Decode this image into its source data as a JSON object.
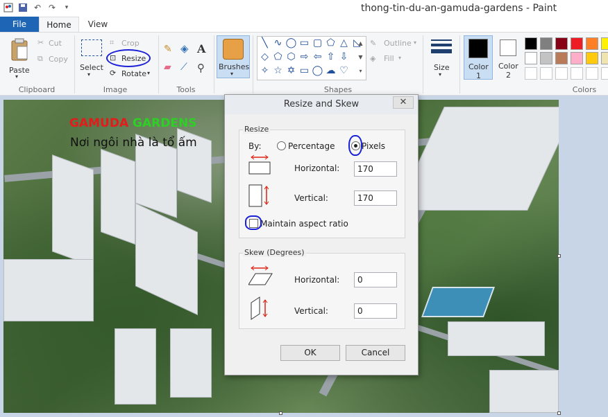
{
  "window": {
    "title": "thong-tin-du-an-gamuda-gardens - Paint"
  },
  "tabs": [
    "File",
    "Home",
    "View"
  ],
  "ribbon": {
    "clipboard": {
      "paste": "Paste",
      "cut": "Cut",
      "copy": "Copy",
      "group": "Clipboard"
    },
    "image": {
      "select": "Select",
      "crop": "Crop",
      "resize": "Resize",
      "rotate": "Rotate",
      "group": "Image"
    },
    "tools": {
      "group": "Tools"
    },
    "brushes": {
      "label": "Brushes"
    },
    "shapes": {
      "outline": "Outline",
      "fill": "Fill",
      "group": "Shapes"
    },
    "size": {
      "label": "Size"
    },
    "color1": {
      "label": "Color",
      "num": "1"
    },
    "color2": {
      "label": "Color",
      "num": "2"
    },
    "colors_group": "Colors",
    "palette": [
      "#000000",
      "#7f7f7f",
      "#880015",
      "#ed1c24",
      "#ff7f27",
      "#fff200",
      "#ffffff",
      "#c3c3c3",
      "#b97a57",
      "#ffaec9",
      "#ffc90e",
      "#efe4b0"
    ]
  },
  "picture": {
    "brand_part1": "GAMUDA",
    "brand_part2": "GARDENS",
    "slogan": "Nơi ngôi nhà là tổ ấm"
  },
  "dialog": {
    "title": "Resize and Skew",
    "close": "✕",
    "resize_legend": "Resize",
    "by": "By:",
    "percentage": "Percentage",
    "pixels": "Pixels",
    "horizontal": "Horizontal:",
    "vertical": "Vertical:",
    "resize_h": "170",
    "resize_v": "170",
    "maintain": "Maintain aspect ratio",
    "skew_legend": "Skew (Degrees)",
    "skew_h": "0",
    "skew_v": "0",
    "ok": "OK",
    "cancel": "Cancel"
  }
}
